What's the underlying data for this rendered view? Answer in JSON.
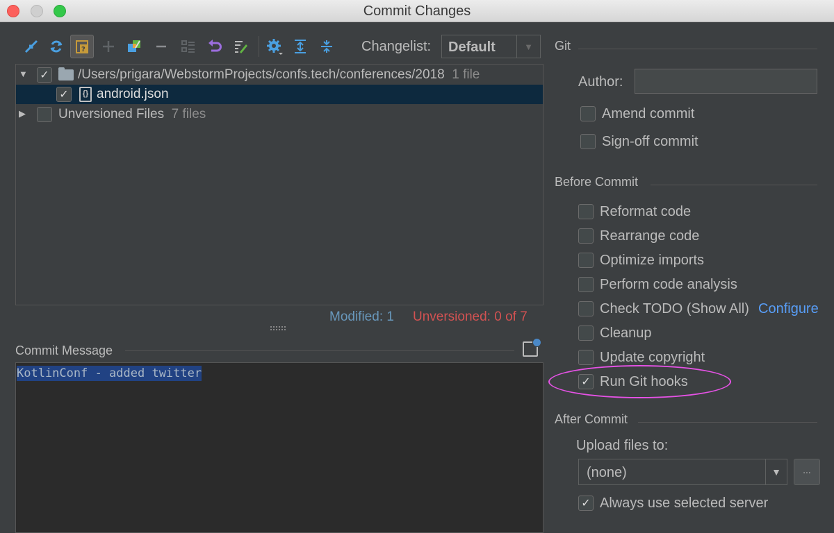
{
  "window": {
    "title": "Commit Changes"
  },
  "toolbar": {
    "icons": [
      "move-changes-icon",
      "refresh-icon",
      "group-by-icon",
      "add-icon",
      "diff-icon",
      "remove-icon",
      "ignore-icon",
      "revert-icon",
      "edit-icon",
      "settings-icon",
      "expand-all-icon",
      "collapse-all-icon"
    ],
    "changelist_label": "Changelist:",
    "changelist_value": "Default"
  },
  "tree": {
    "rows": [
      {
        "path": "/Users/prigara/WebstormProjects/confs.tech/conferences/2018",
        "count": "1 file",
        "checked": true,
        "expanded": true
      },
      {
        "name": "android.json",
        "checked": true,
        "selected": true
      },
      {
        "name": "Unversioned Files",
        "count": "7 files",
        "checked": false,
        "expanded": false
      }
    ]
  },
  "status": {
    "modified": "Modified: 1",
    "unversioned": "Unversioned: 0 of 7"
  },
  "commit_message": {
    "title": "Commit Message",
    "text": "KotlinConf - added twitter"
  },
  "git": {
    "title": "Git",
    "author_label": "Author:",
    "author_value": "",
    "amend": {
      "label": "Amend commit",
      "checked": false
    },
    "signoff": {
      "label": "Sign-off commit",
      "checked": false
    }
  },
  "before_commit": {
    "title": "Before Commit",
    "options": [
      {
        "label": "Reformat code",
        "checked": false
      },
      {
        "label": "Rearrange code",
        "checked": false
      },
      {
        "label": "Optimize imports",
        "checked": false
      },
      {
        "label": "Perform code analysis",
        "checked": false
      },
      {
        "label": "Check TODO (Show All)",
        "checked": false,
        "link": "Configure"
      },
      {
        "label": "Cleanup",
        "checked": false
      },
      {
        "label": "Update copyright",
        "checked": false
      },
      {
        "label": "Run Git hooks",
        "checked": true
      }
    ]
  },
  "after_commit": {
    "title": "After Commit",
    "upload_label": "Upload files to:",
    "upload_value": "(none)",
    "dots": "...",
    "always_use": {
      "label": "Always use selected server",
      "checked": true
    }
  },
  "colors": {
    "accent_link": "#589df6",
    "modified": "#6897bb",
    "unversioned": "#d25252",
    "highlight": "#e552e5",
    "selection": "#0d293e"
  }
}
